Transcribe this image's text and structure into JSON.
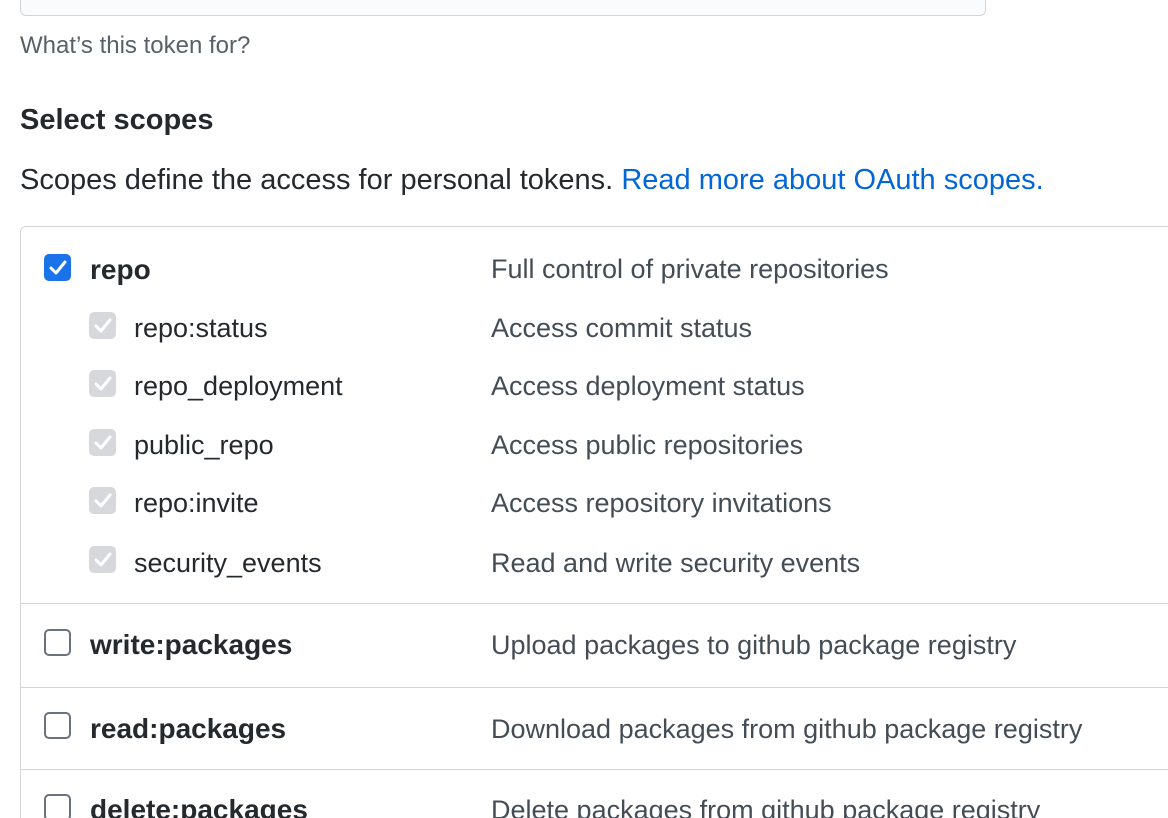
{
  "note": {
    "hint": "What’s this token for?"
  },
  "scopes_section": {
    "title": "Select scopes",
    "description": "Scopes define the access for personal tokens.",
    "link_label": "Read more about OAuth scopes."
  },
  "scopes": {
    "repo": {
      "name": "repo",
      "description": "Full control of private repositories",
      "checked": true,
      "children": [
        {
          "name": "repo:status",
          "description": "Access commit status",
          "checked": true
        },
        {
          "name": "repo_deployment",
          "description": "Access deployment status",
          "checked": true
        },
        {
          "name": "public_repo",
          "description": "Access public repositories",
          "checked": true
        },
        {
          "name": "repo:invite",
          "description": "Access repository invitations",
          "checked": true
        },
        {
          "name": "security_events",
          "description": "Read and write security events",
          "checked": true
        }
      ]
    },
    "write_packages": {
      "name": "write:packages",
      "description": "Upload packages to github package registry",
      "checked": false
    },
    "read_packages": {
      "name": "read:packages",
      "description": "Download packages from github package registry",
      "checked": false
    },
    "delete_packages": {
      "name": "delete:packages",
      "description": "Delete packages from github package registry",
      "checked": false
    }
  },
  "colors": {
    "accent": "#1a73e8",
    "link": "#0366d6",
    "border": "#d1d5da",
    "disabled_checkbox": "#d6d8db"
  }
}
